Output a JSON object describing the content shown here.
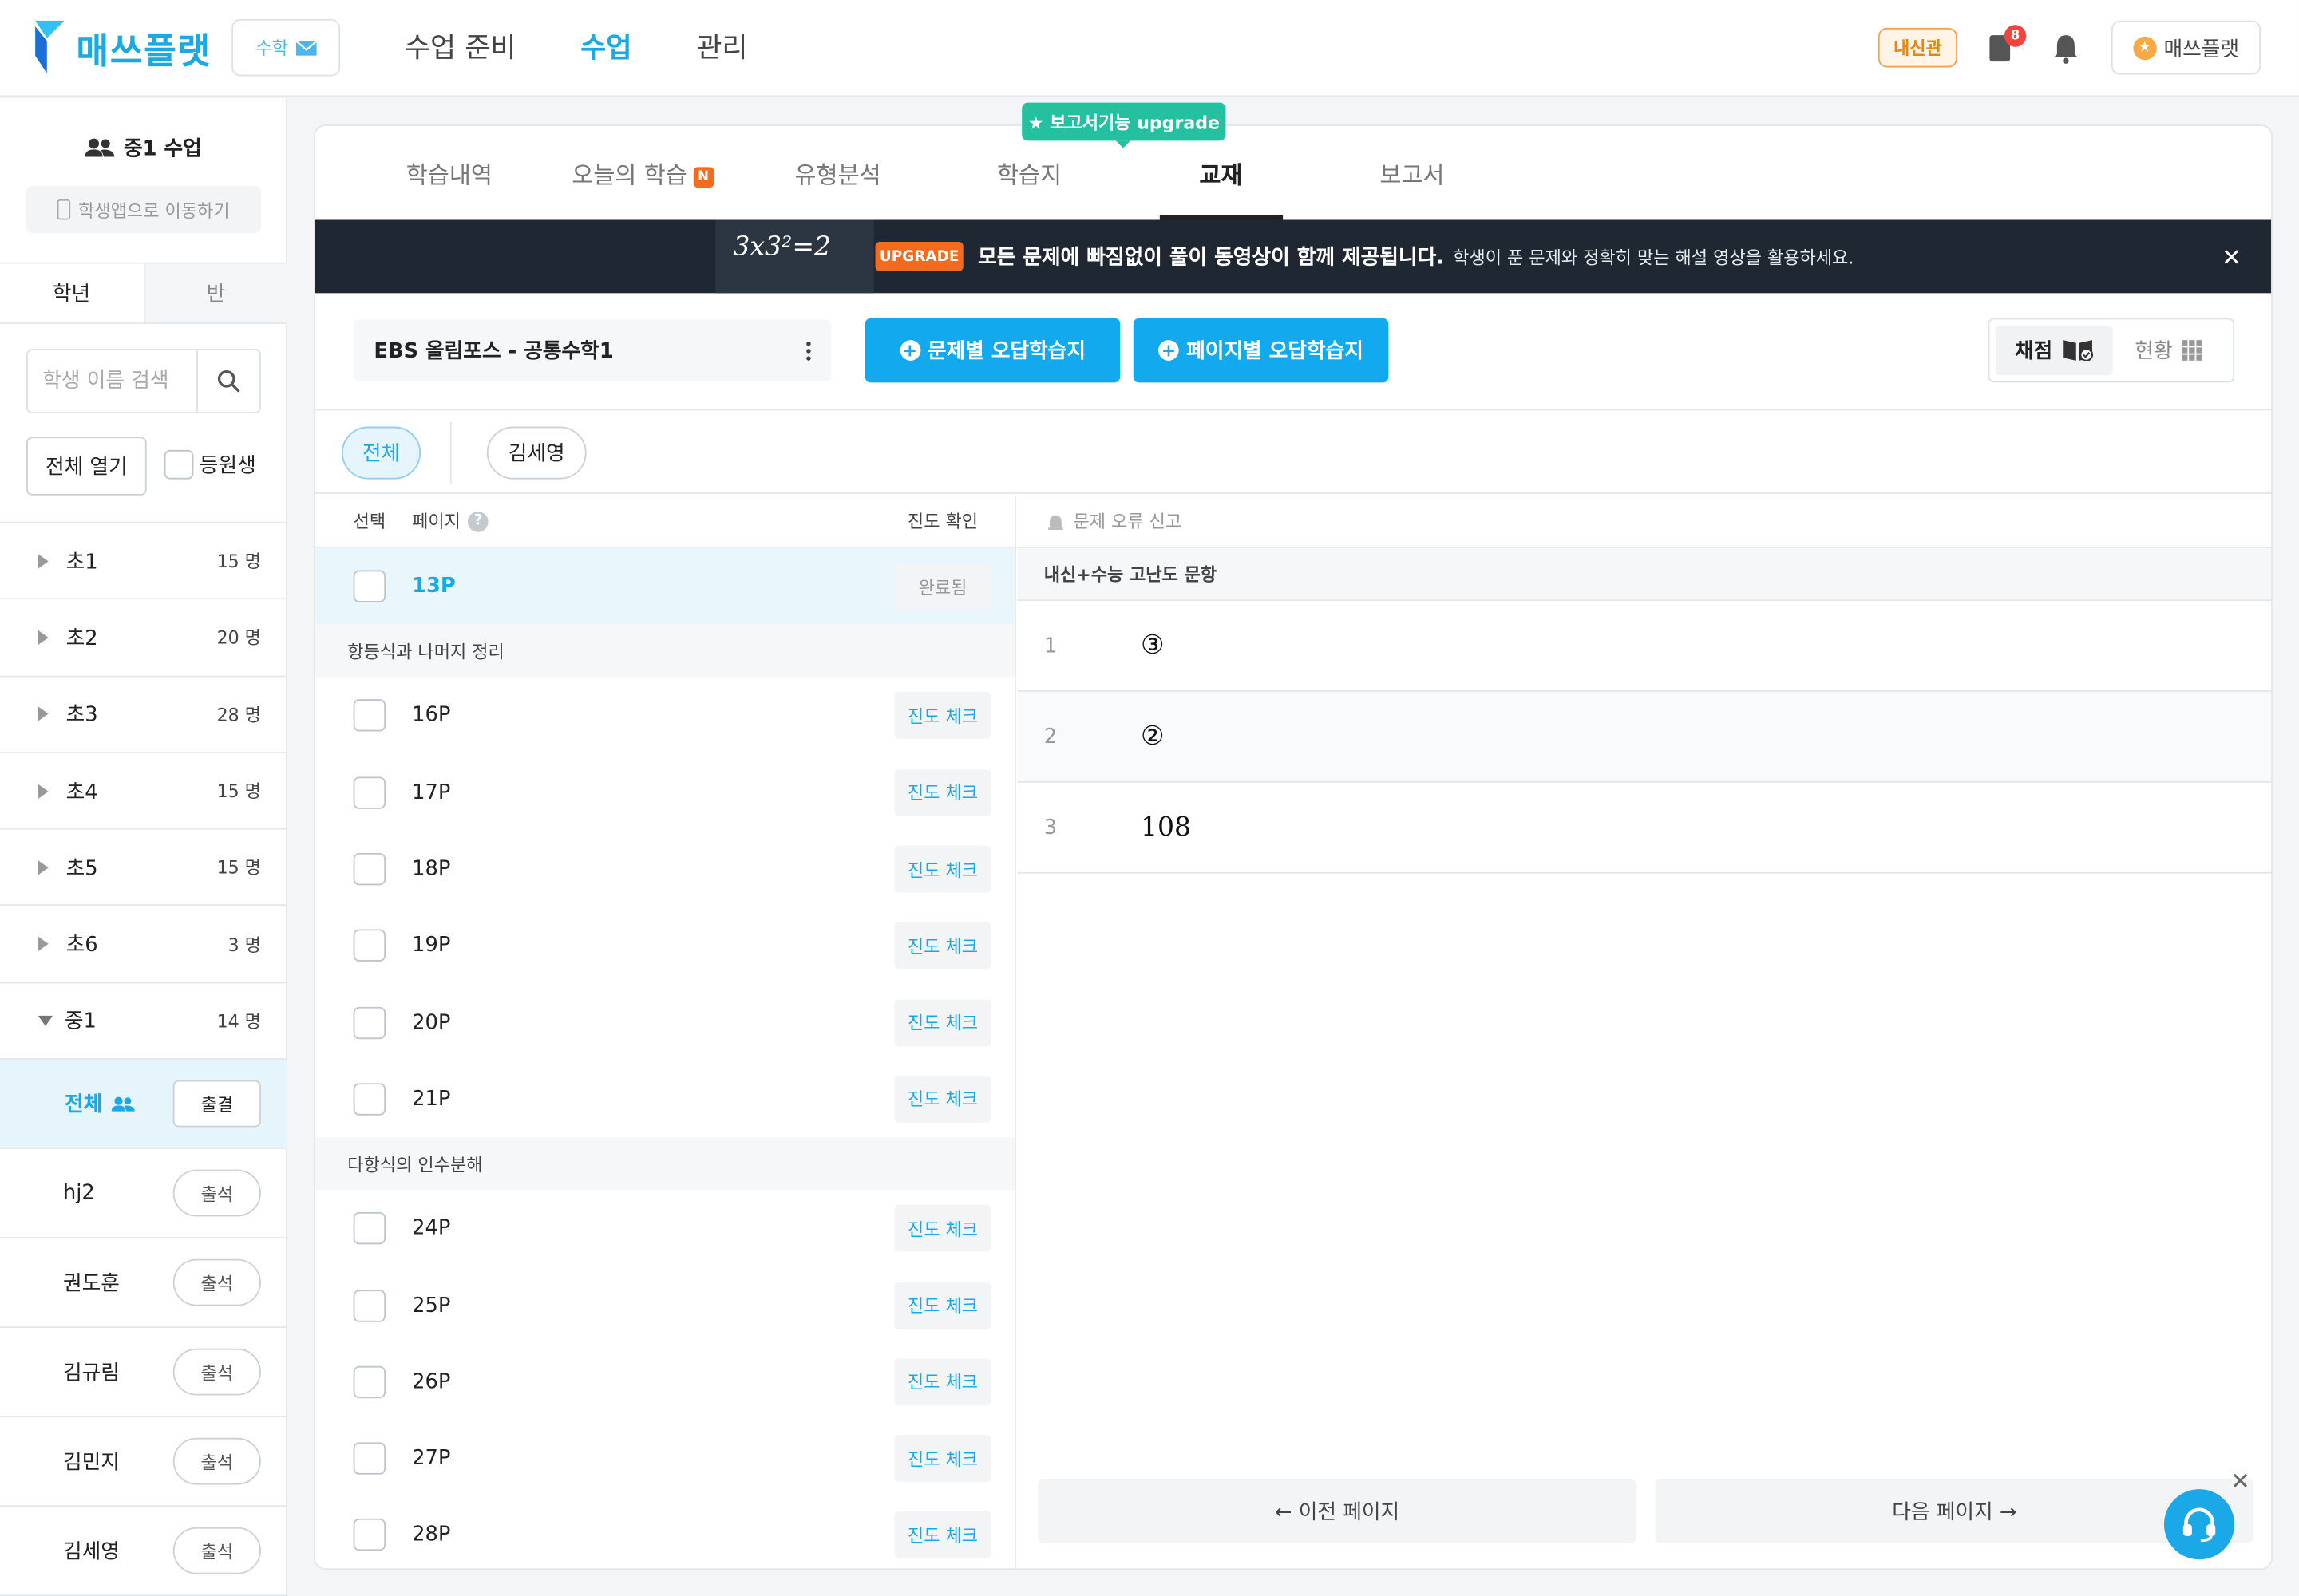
{
  "app": {
    "logo_text": "매쓰플랫",
    "subject": "수학",
    "nav": [
      "수업 준비",
      "수업",
      "관리"
    ],
    "nav_active_index": 1,
    "badge_label": "내신관",
    "notification_count": "8",
    "account_label": "매쓰플랫",
    "brand_color": "#1aa8e6"
  },
  "sidebar": {
    "class_title": "중1 수업",
    "move_app": "학생앱으로 이동하기",
    "tabs": [
      "학년",
      "반"
    ],
    "search_placeholder": "학생 이름 검색",
    "open_all": "전체 열기",
    "enrolled_label": "등원생",
    "grades": [
      {
        "name": "초1",
        "count": "15 명"
      },
      {
        "name": "초2",
        "count": "20 명"
      },
      {
        "name": "초3",
        "count": "28 명"
      },
      {
        "name": "초4",
        "count": "15 명"
      },
      {
        "name": "초5",
        "count": "15 명"
      },
      {
        "name": "초6",
        "count": "3 명"
      },
      {
        "name": "중1",
        "count": "14 명"
      }
    ],
    "all_label": "전체",
    "attendance_button": "출결",
    "students": [
      {
        "name": "hj2",
        "action": "출석"
      },
      {
        "name": "권도훈",
        "action": "출석"
      },
      {
        "name": "김규림",
        "action": "출석"
      },
      {
        "name": "김민지",
        "action": "출석"
      },
      {
        "name": "김세영",
        "action": "출석"
      }
    ]
  },
  "main": {
    "tabs": [
      "학습내역",
      "오늘의 학습",
      "유형분석",
      "학습지",
      "교재",
      "보고서"
    ],
    "active_tab_index": 4,
    "new_badge": "N",
    "upgrade_tag": "★ 보고서기능 upgrade",
    "banner": {
      "art_text": "3x3²=2",
      "badge": "UPGRADE",
      "main": "모든 문제에 빠짐없이 풀이 동영상이 함께 제공됩니다.",
      "sub": "학생이 푼 문제와 정확히 맞는 해설 영상을 활용하세요.",
      "close": "✕"
    },
    "book_name": "EBS 올림포스 - 공통수학1",
    "btn_problem_wrong": "문제별 오답학습지",
    "btn_page_wrong": "페이지별 오답학습지",
    "view_toggle": {
      "grading": "채점",
      "status": "현황"
    },
    "filter_chips": [
      "전체",
      "김세영"
    ],
    "list_header": {
      "select": "선택",
      "page": "페이지",
      "progress": "진도 확인"
    },
    "selected_page": {
      "label": "13P",
      "status": "완료됨"
    },
    "sections": [
      {
        "title": "항등식과 나머지 정리",
        "pages": [
          {
            "label": "16P",
            "action": "진도 체크"
          },
          {
            "label": "17P",
            "action": "진도 체크"
          },
          {
            "label": "18P",
            "action": "진도 체크"
          },
          {
            "label": "19P",
            "action": "진도 체크"
          },
          {
            "label": "20P",
            "action": "진도 체크"
          },
          {
            "label": "21P",
            "action": "진도 체크"
          }
        ]
      },
      {
        "title": "다항식의 인수분해",
        "pages": [
          {
            "label": "24P",
            "action": "진도 체크"
          },
          {
            "label": "25P",
            "action": "진도 체크"
          },
          {
            "label": "26P",
            "action": "진도 체크"
          },
          {
            "label": "27P",
            "action": "진도 체크"
          },
          {
            "label": "28P",
            "action": "진도 체크"
          }
        ]
      }
    ],
    "right": {
      "report_error": "문제 오류 신고",
      "section_title": "내신+수능 고난도 문항",
      "answers": [
        {
          "num": "1",
          "value": "③"
        },
        {
          "num": "2",
          "value": "②"
        },
        {
          "num": "3",
          "value": "108"
        }
      ],
      "prev_page": "← 이전 페이지",
      "next_page": "다음 페이지 →"
    }
  }
}
